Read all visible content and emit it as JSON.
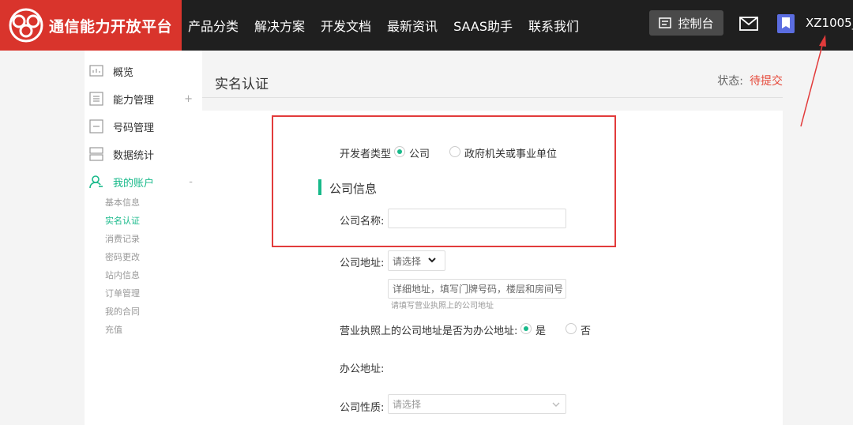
{
  "header": {
    "logo_text": "通信能力开放平台",
    "nav": [
      "产品分类",
      "解决方案",
      "开发文档",
      "最新资讯",
      "SAAS助手",
      "联系我们"
    ],
    "console_label": "控制台",
    "username": "XZ1005_"
  },
  "sidebar": {
    "items": [
      {
        "label": "概览",
        "icon": "overview-icon"
      },
      {
        "label": "能力管理",
        "icon": "capability-icon",
        "toggle": "+"
      },
      {
        "label": "号码管理",
        "icon": "number-icon"
      },
      {
        "label": "数据统计",
        "icon": "stats-icon"
      },
      {
        "label": "我的账户",
        "icon": "account-icon",
        "toggle": "-"
      }
    ],
    "sub_items": [
      "基本信息",
      "实名认证",
      "消费记录",
      "密码更改",
      "站内信息",
      "订单管理",
      "我的合同",
      "充值"
    ],
    "active_sub": "实名认证"
  },
  "page": {
    "title": "实名认证",
    "status_label": "状态:",
    "status_value": "待提交"
  },
  "form": {
    "developer_type_label": "开发者类型",
    "developer_type_options": [
      "公司",
      "政府机关或事业单位"
    ],
    "developer_type_selected": "公司",
    "section_title": "公司信息",
    "company_name_label": "公司名称:",
    "company_name_value": "",
    "company_address_label": "公司地址:",
    "address_select_value": "请选择",
    "address_detail_placeholder": "详细地址，填写门牌号码，楼层和房间号",
    "address_hint": "请填写营业执照上的公司地址",
    "office_same_label": "营业执照上的公司地址是否为办公地址:",
    "office_same_options": [
      "是",
      "否"
    ],
    "office_same_selected": "是",
    "office_address_label": "办公地址:",
    "company_nature_label": "公司性质:",
    "company_nature_placeholder": "请选择"
  },
  "colors": {
    "accent": "#18b98a",
    "brand": "#d9342c",
    "status": "#e64a3b",
    "annotation": "#e23b3b"
  }
}
